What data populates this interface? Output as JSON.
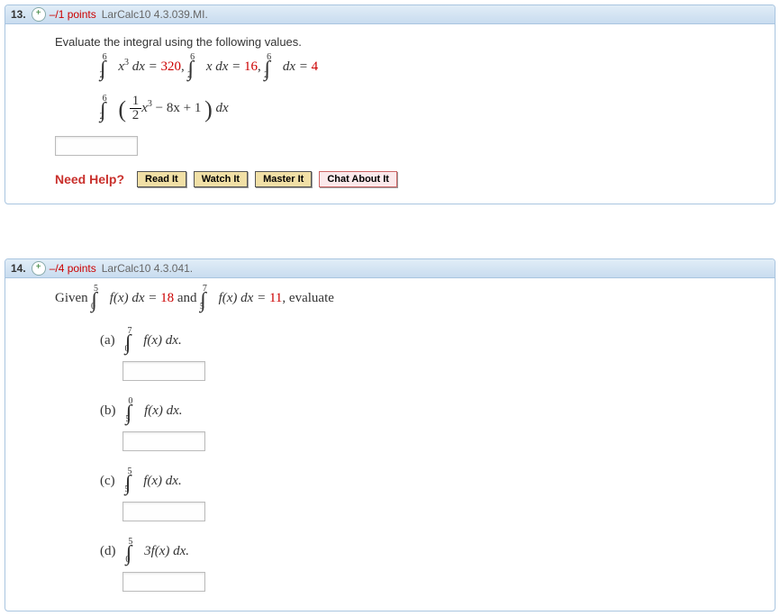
{
  "q13": {
    "number": "13.",
    "expand": "+",
    "points": "–/1 points",
    "ref": "LarCalc10 4.3.039.MI.",
    "prompt": "Evaluate the integral using the following values.",
    "given": {
      "int1_ub": "6",
      "int1_lb": "2",
      "int1_expr": "x",
      "int1_pow": "3",
      "int1_dx": " dx = ",
      "int1_val": "320",
      "sep1": ",   ",
      "int2_ub": "6",
      "int2_lb": "2",
      "int2_expr": "x dx = ",
      "int2_val": "16",
      "sep2": ",   ",
      "int3_ub": "6",
      "int3_lb": "2",
      "int3_expr": "dx = ",
      "int3_val": "4"
    },
    "target": {
      "ub": "6",
      "lb": "2",
      "frac_n": "1",
      "frac_d": "2",
      "x": "x",
      "pow": "3",
      "mid": " − 8x + 1",
      "dx": " dx"
    },
    "needHelp": "Need Help?",
    "buttons": {
      "read": "Read It",
      "watch": "Watch It",
      "master": "Master It",
      "chat": "Chat About It"
    }
  },
  "q14": {
    "number": "14.",
    "expand": "+",
    "points": "–/4 points",
    "ref": "LarCalc10 4.3.041.",
    "givenLabel": "Given  ",
    "given1": {
      "ub": "5",
      "lb": "0",
      "expr": "f(x) dx = ",
      "val": "18"
    },
    "and": " and ",
    "given2": {
      "ub": "7",
      "lb": "5",
      "expr": "f(x) dx = ",
      "val": "11"
    },
    "evaluate": ",  evaluate",
    "parts": {
      "a": {
        "label": "(a)",
        "ub": "7",
        "lb": "0",
        "expr": "f(x) dx."
      },
      "b": {
        "label": "(b)",
        "ub": "0",
        "lb": "5",
        "expr": "f(x) dx."
      },
      "c": {
        "label": "(c)",
        "ub": "5",
        "lb": "5",
        "expr": "f(x) dx."
      },
      "d": {
        "label": "(d)",
        "ub": "5",
        "lb": "0",
        "expr": "3f(x) dx."
      }
    }
  }
}
